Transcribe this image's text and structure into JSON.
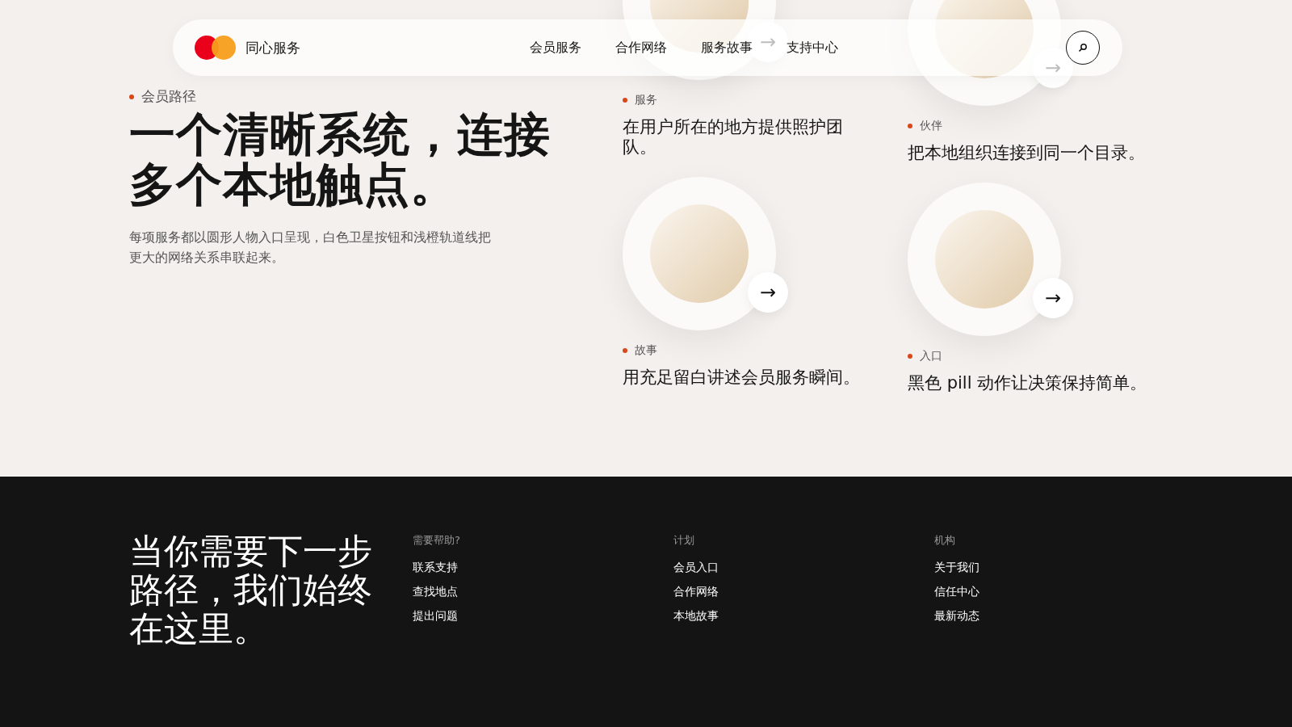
{
  "header": {
    "brand": "同心服务",
    "nav": [
      {
        "label": "会员服务"
      },
      {
        "label": "合作网络"
      },
      {
        "label": "服务故事"
      },
      {
        "label": "支持中心"
      }
    ]
  },
  "hero": {
    "eyebrow": "会员路径",
    "title": "一个清晰系统，连接多个本地触点。",
    "description": "每项服务都以圆形人物入口呈现，白色卫星按钮和浅橙轨道线把更大的网络关系串联起来。"
  },
  "cards": [
    {
      "label": "服务",
      "text": "在用户所在的地方提供照护团队。",
      "arrow": "→"
    },
    {
      "label": "伙伴",
      "text": "把本地组织连接到同一个目录。",
      "arrow": "→"
    },
    {
      "label": "故事",
      "text": "用充足留白讲述会员服务瞬间。",
      "arrow": "→"
    },
    {
      "label": "入口",
      "text": "黑色 pill 动作让决策保持简单。",
      "arrow": "→"
    }
  ],
  "footer": {
    "headline": "当你需要下一步路径，我们始终在这里。",
    "columns": [
      {
        "heading": "需要帮助?",
        "links": [
          "联系支持",
          "查找地点",
          "提出问题"
        ]
      },
      {
        "heading": "计划",
        "links": [
          "会员入口",
          "合作网络",
          "本地故事"
        ]
      },
      {
        "heading": "机构",
        "links": [
          "关于我们",
          "信任中心",
          "最新动态"
        ]
      }
    ]
  }
}
